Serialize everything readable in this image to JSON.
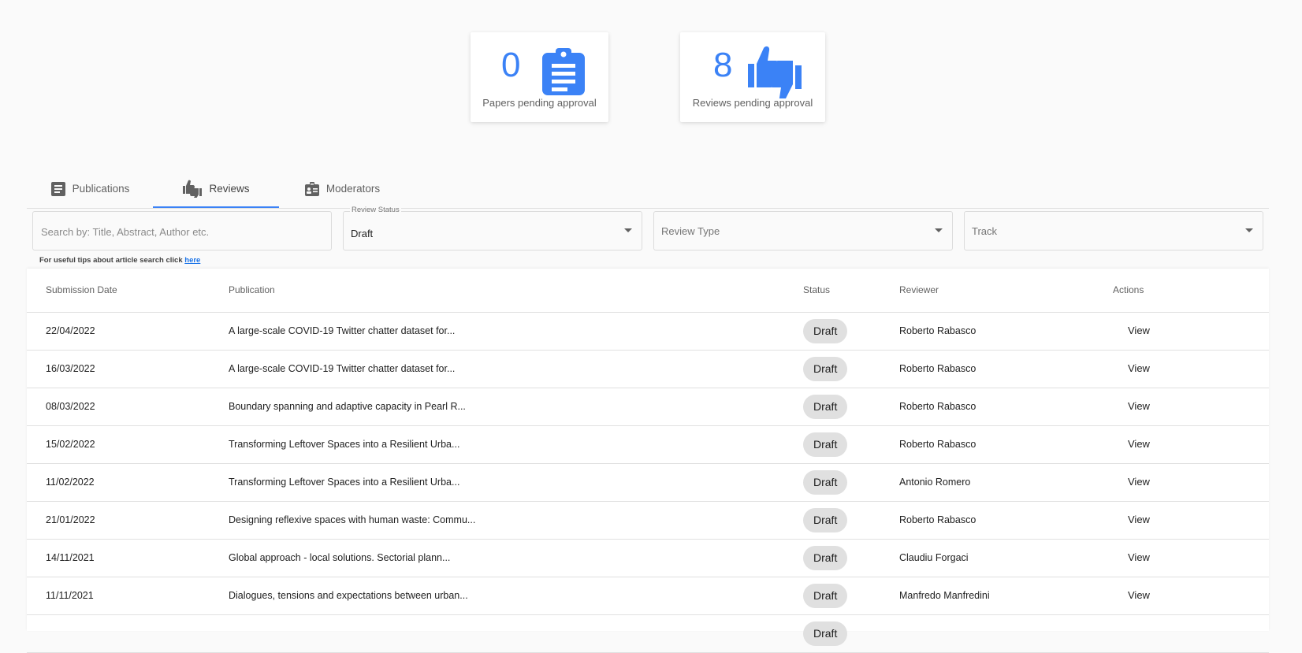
{
  "colors": {
    "accent": "#3b82f6",
    "chip_bg": "#e0e0e0",
    "link": "#1a73e8"
  },
  "stats": {
    "papers": {
      "value": "0",
      "label": "Papers pending approval",
      "icon": "clipboard-icon"
    },
    "reviews": {
      "value": "8",
      "label": "Reviews pending approval",
      "icon": "thumbs-up-down-icon"
    }
  },
  "tabs": [
    {
      "label": "Publications",
      "icon": "article-icon"
    },
    {
      "label": "Reviews",
      "icon": "thumbs-up-down-icon",
      "active": true
    },
    {
      "label": "Moderators",
      "icon": "badge-icon"
    }
  ],
  "filters": {
    "search_placeholder": "Search by: Title, Abstract, Author etc.",
    "review_status_label": "Review Status",
    "review_status_value": "Draft",
    "review_type_placeholder": "Review Type",
    "track_placeholder": "Track"
  },
  "tip": {
    "text": "For useful tips about article search click ",
    "link": "here"
  },
  "table": {
    "headers": [
      "Submission Date",
      "Publication",
      "Status",
      "Reviewer",
      "Actions"
    ],
    "rows": [
      {
        "date": "22/04/2022",
        "publication": "A large-scale COVID-19 Twitter chatter dataset for...",
        "status": "Draft",
        "reviewer": "Roberto Rabasco",
        "action": "View"
      },
      {
        "date": "16/03/2022",
        "publication": "A large-scale COVID-19 Twitter chatter dataset for...",
        "status": "Draft",
        "reviewer": "Roberto Rabasco",
        "action": "View"
      },
      {
        "date": "08/03/2022",
        "publication": "Boundary spanning and adaptive capacity in Pearl R...",
        "status": "Draft",
        "reviewer": "Roberto Rabasco",
        "action": "View"
      },
      {
        "date": "15/02/2022",
        "publication": "Transforming Leftover Spaces into a Resilient Urba...",
        "status": "Draft",
        "reviewer": "Roberto Rabasco",
        "action": "View"
      },
      {
        "date": "11/02/2022",
        "publication": "Transforming Leftover Spaces into a Resilient Urba...",
        "status": "Draft",
        "reviewer": "Antonio Romero",
        "action": "View"
      },
      {
        "date": "21/01/2022",
        "publication": "Designing reflexive spaces with human waste: Commu...",
        "status": "Draft",
        "reviewer": "Roberto Rabasco",
        "action": "View"
      },
      {
        "date": "14/11/2021",
        "publication": "Global approach - local solutions. Sectorial plann...",
        "status": "Draft",
        "reviewer": "Claudiu Forgaci",
        "action": "View"
      },
      {
        "date": "11/11/2021",
        "publication": "Dialogues, tensions and expectations between urban...",
        "status": "Draft",
        "reviewer": "Manfredo Manfredini",
        "action": "View"
      },
      {
        "date": "",
        "publication": "",
        "status": "Draft",
        "reviewer": "",
        "action": ""
      }
    ]
  }
}
